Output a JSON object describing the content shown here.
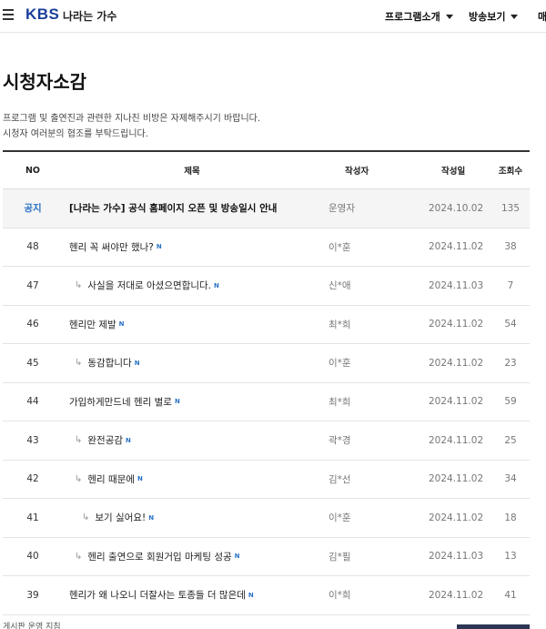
{
  "header": {
    "logo": "KBS",
    "program_title": "나라는 가수",
    "menu_icon": "hamburger-menu-icon",
    "nav": [
      {
        "label": "프로그램소개"
      },
      {
        "label": "방송보기"
      },
      {
        "label": "매"
      }
    ]
  },
  "page": {
    "title": "시청자소감",
    "notice_lines": [
      "프로그램 및 출연진과 관련한 지나친 비방은 자제해주시기 바랍니다.",
      "시청자 여러분의 협조를 부탁드립니다."
    ]
  },
  "board": {
    "columns": {
      "no": "NO",
      "title": "제목",
      "writer": "작성자",
      "date": "작성일",
      "views": "조회수"
    },
    "new_badge": "N",
    "rows": [
      {
        "no": "공지",
        "title": "[나라는 가수] 공식 홈페이지 오픈 및 방송일시 안내",
        "writer": "운영자",
        "date": "2024.10.02",
        "views": "135"
      },
      {
        "no": "48",
        "title": "헨리 꼭 써야만 했나?",
        "writer": "이*훈",
        "date": "2024.11.02",
        "views": "38"
      },
      {
        "no": "47",
        "title": "사실을 저대로 아셨으면합니다.",
        "writer": "신*애",
        "date": "2024.11.03",
        "views": "7"
      },
      {
        "no": "46",
        "title": "헨리만 제발",
        "writer": "최*희",
        "date": "2024.11.02",
        "views": "54"
      },
      {
        "no": "45",
        "title": "동감합니다",
        "writer": "이*훈",
        "date": "2024.11.02",
        "views": "23"
      },
      {
        "no": "44",
        "title": "가입하게만드네 헨리 별로",
        "writer": "최*희",
        "date": "2024.11.02",
        "views": "59"
      },
      {
        "no": "43",
        "title": "완전공감",
        "writer": "곽*경",
        "date": "2024.11.02",
        "views": "25"
      },
      {
        "no": "42",
        "title": "헨리 때문에",
        "writer": "김*선",
        "date": "2024.11.02",
        "views": "34"
      },
      {
        "no": "41",
        "title": "보기 싫어요!",
        "writer": "이*훈",
        "date": "2024.11.02",
        "views": "18"
      },
      {
        "no": "40",
        "title": "헨리 출연으로 회원거입 마케팅 성공",
        "writer": "김*필",
        "date": "2024.11.03",
        "views": "13"
      },
      {
        "no": "39",
        "title": "헨리가 왜 나오니 더잘사는 토종들 더 많은데",
        "writer": "이*희",
        "date": "2024.11.02",
        "views": "41"
      }
    ]
  },
  "footer": {
    "text": "게시판 운영 지침"
  },
  "colors": {
    "brand": "#1a3e9c",
    "notice_label": "#2a73c5",
    "new_badge": "#2a73c5",
    "write_button": "#2c3553"
  }
}
